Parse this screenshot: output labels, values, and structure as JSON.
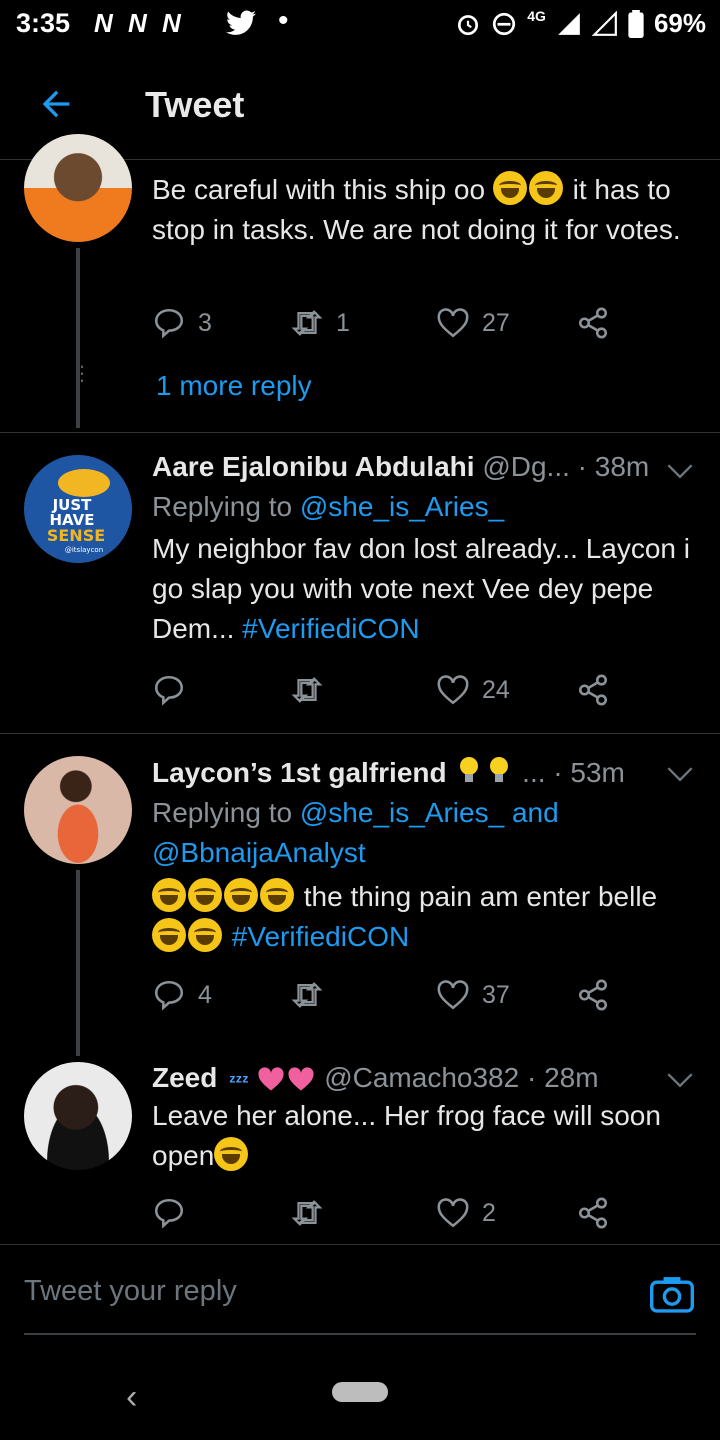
{
  "status_bar": {
    "time": "3:35",
    "app_icons": "N N N",
    "network": "4G",
    "battery": "69%"
  },
  "header": {
    "title": "Tweet"
  },
  "tweets": [
    {
      "text": "Be careful with this ship oo",
      "text_after_emoji": "it has to stop in tasks. We are not doing it for votes.",
      "replies": "3",
      "retweets": "1",
      "likes": "27",
      "more_replies": "1 more reply"
    },
    {
      "name": "Aare Ejalonibu Abdulahi",
      "handle": "@Dg...",
      "time": "· 38m",
      "replying_prefix": "Replying to",
      "replying_to": "@she_is_Aries_",
      "text": "My neighbor fav don lost already... Laycon i go slap you with vote next Vee dey pepe Dem...",
      "hashtag": "#VerifiediCON",
      "replies": "",
      "retweets": "",
      "likes": "24",
      "avatar_text": [
        "JUST",
        "HAVE",
        "SENSE",
        "@itslaycon"
      ]
    },
    {
      "name": "Laycon’s 1st galfriend",
      "handle": "...",
      "time": "· 53m",
      "replying_prefix": "Replying to",
      "replying_to": "@she_is_Aries_",
      "replying_and": "and",
      "replying_to2": "@BbnaijaAnalyst",
      "text": "the thing pain am enter belle",
      "hashtag": "#VerifiediCON",
      "replies": "4",
      "retweets": "",
      "likes": "37"
    },
    {
      "name": "Zeed",
      "handle": "@Camacho382",
      "time": "· 28m",
      "text": "Leave her alone... Her frog face will soon open",
      "replies": "",
      "retweets": "",
      "likes": "2"
    }
  ],
  "reply_bar": {
    "placeholder": "Tweet your reply"
  },
  "colors": {
    "accent": "#1d9bf0",
    "background": "#000000",
    "muted": "#8b9298"
  },
  "icons": [
    "back-arrow-icon",
    "reply-icon",
    "retweet-icon",
    "like-icon",
    "share-icon",
    "chevron-down-icon",
    "camera-icon",
    "alarm-icon",
    "dnd-icon",
    "signal-icon",
    "battery-icon",
    "twitter-icon"
  ]
}
